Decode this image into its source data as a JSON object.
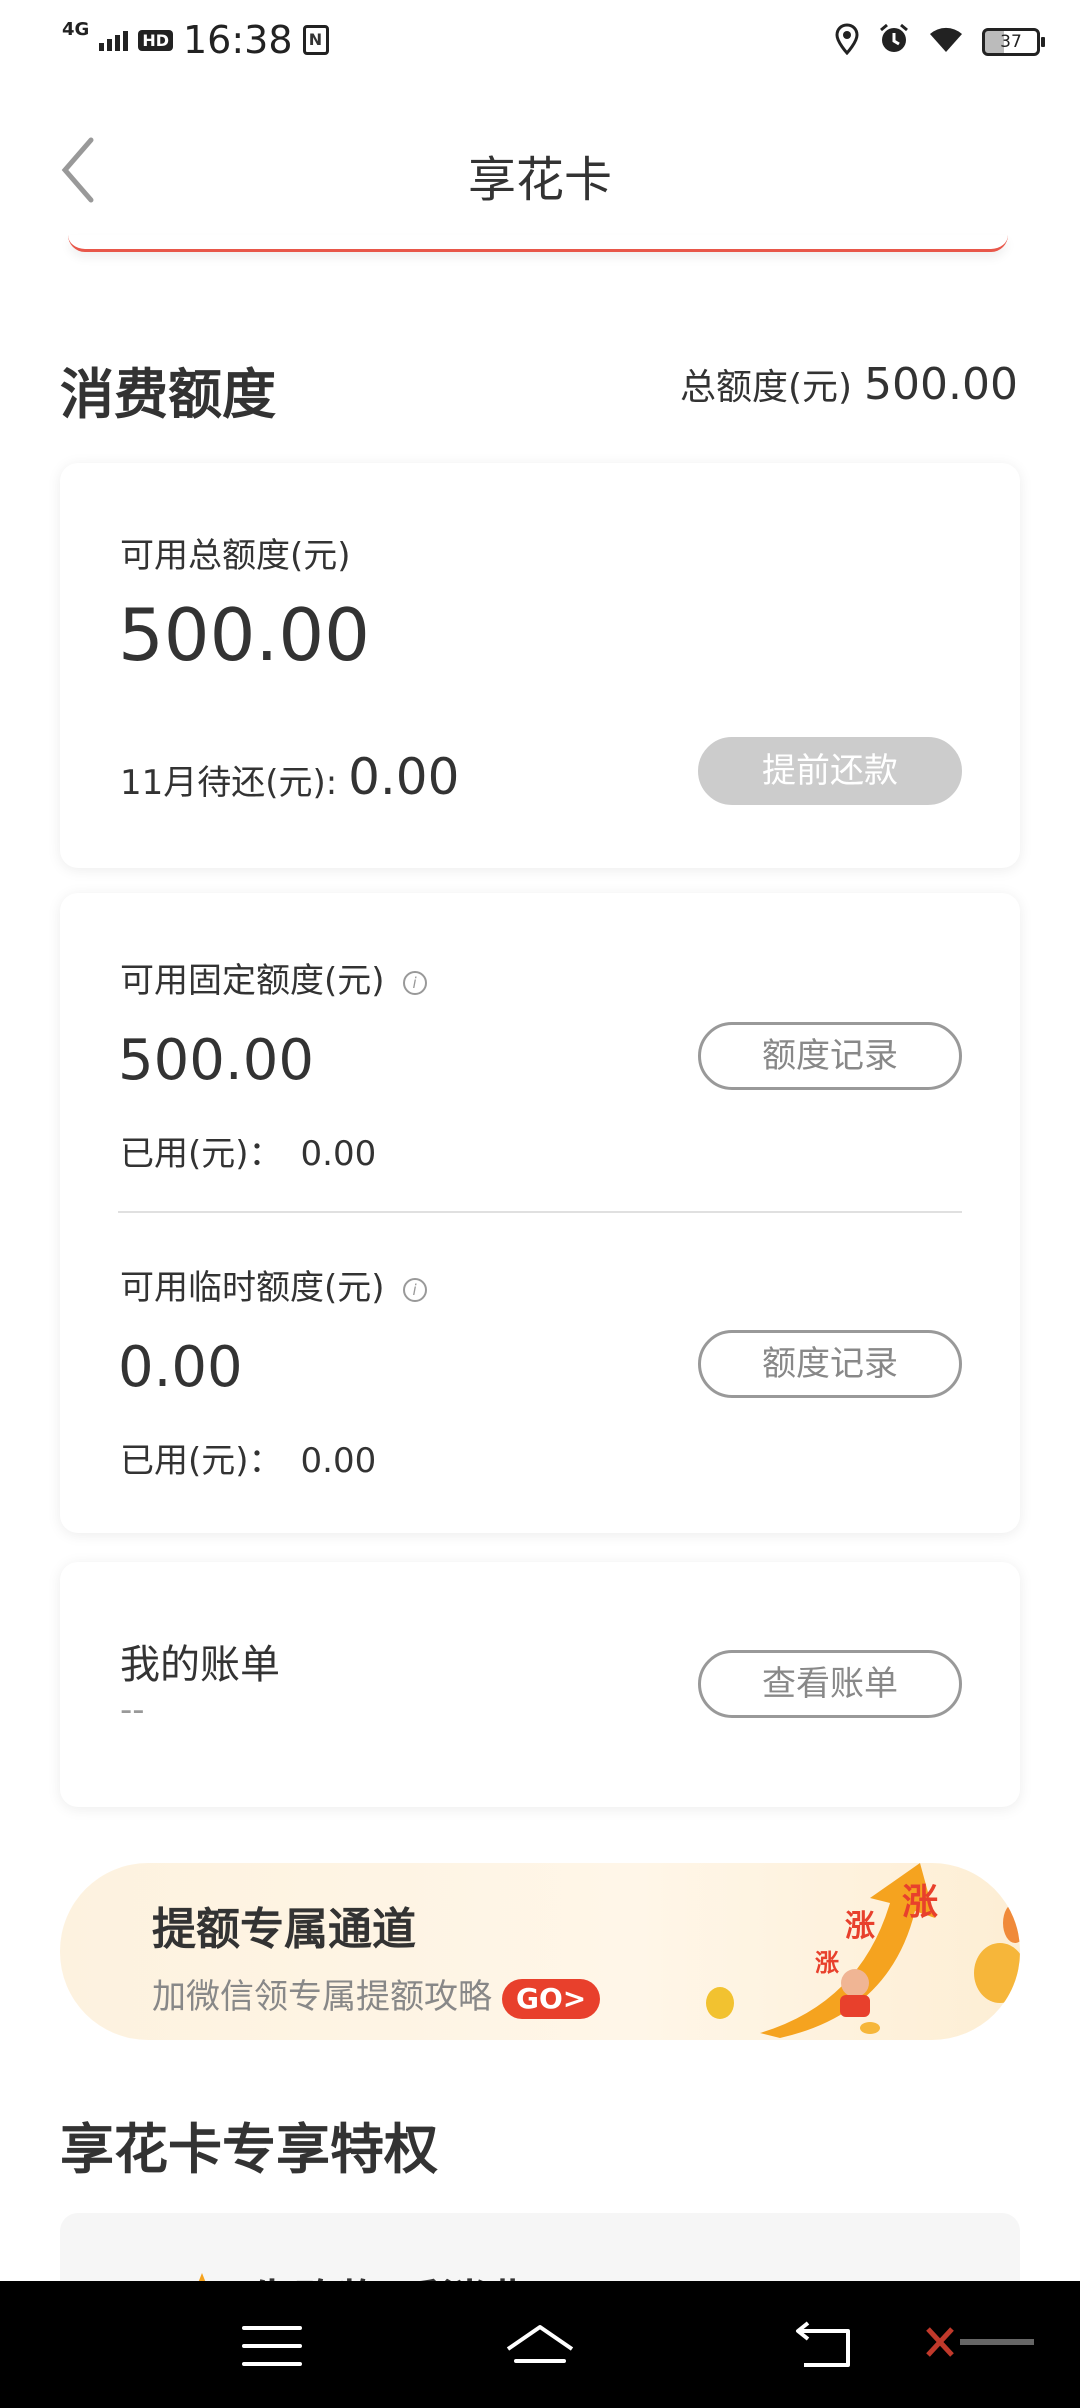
{
  "status_bar": {
    "network": "4G",
    "hd": "HD",
    "time": "16:38",
    "nfc": "N",
    "battery": "37"
  },
  "nav": {
    "title": "享花卡"
  },
  "credit": {
    "section_title": "消费额度",
    "total_label": "总额度(元)",
    "total_value": "500.00",
    "available_label": "可用总额度(元)",
    "available_value": "500.00",
    "due_label": "11月待还(元):",
    "due_value": "0.00",
    "repay_button": "提前还款"
  },
  "fixed": {
    "label": "可用固定额度(元)",
    "info": "i",
    "value": "500.00",
    "used_label": "已用(元)：",
    "used_value": "0.00",
    "record_button": "额度记录"
  },
  "temp": {
    "label": "可用临时额度(元)",
    "info": "i",
    "value": "0.00",
    "used_label": "已用(元)：",
    "used_value": "0.00",
    "record_button": "额度记录"
  },
  "bill": {
    "title": "我的账单",
    "placeholder": "--",
    "view_button": "查看账单"
  },
  "banner": {
    "title": "提额专属通道",
    "subtitle": "加微信领专属提额攻略",
    "go": "GO>",
    "badge": "涨"
  },
  "privilege": {
    "title": "享花卡专享特权",
    "item_text": "先购物 后消费"
  },
  "colors": {
    "accent": "#e8402c",
    "strip": "#e8574a"
  }
}
